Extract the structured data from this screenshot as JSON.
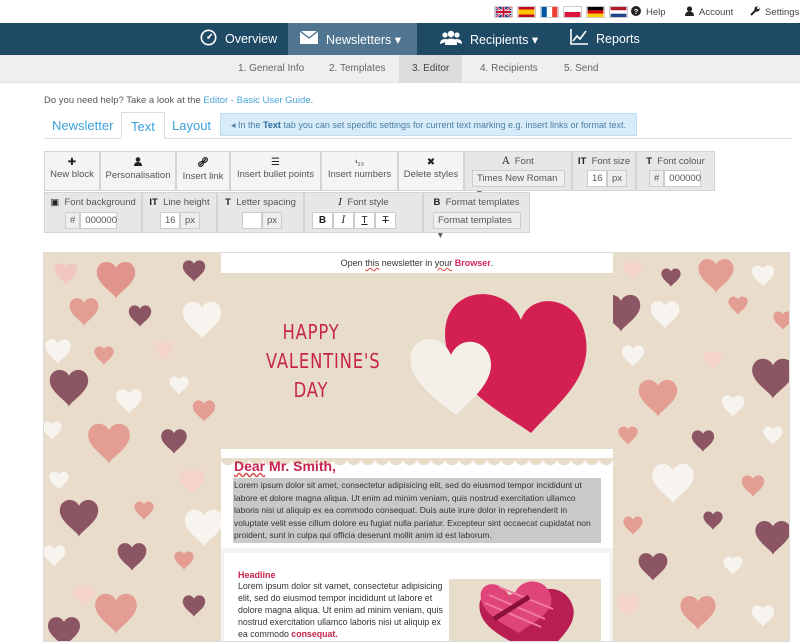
{
  "topbar": {
    "flags": [
      {
        "name": "flag-uk-icon",
        "colors": [
          "#1a3b8a",
          "#c8102e",
          "#ffffff"
        ]
      },
      {
        "name": "flag-spain-icon",
        "colors": [
          "#c60b1e",
          "#ffc400",
          "#c60b1e"
        ]
      },
      {
        "name": "flag-france-icon",
        "colors": [
          "#0055a4",
          "#ffffff",
          "#ef4135"
        ]
      },
      {
        "name": "flag-poland-icon",
        "colors": [
          "#ffffff",
          "#dc143c"
        ]
      },
      {
        "name": "flag-germany-icon",
        "colors": [
          "#000000",
          "#dd0000",
          "#ffce00"
        ]
      },
      {
        "name": "flag-netherlands-icon",
        "colors": [
          "#ae1c28",
          "#ffffff",
          "#21468b"
        ]
      }
    ],
    "help": "Help",
    "account": "Account",
    "settings": "Settings"
  },
  "nav": {
    "overview": "Overview",
    "newsletters": "Newsletters ▾",
    "recipients": "Recipients ▾",
    "reports": "Reports"
  },
  "steps": [
    "1. General Info",
    "2. Templates",
    "3. Editor",
    "4. Recipients",
    "5. Send"
  ],
  "help": {
    "prefix": "Do you need help? Take a look at the ",
    "link": "Editor - Basic User Guide",
    "suffix": "."
  },
  "tabs": [
    "Newsletter",
    "Text",
    "Layout"
  ],
  "hint": {
    "prefix": "◂ In the ",
    "bold": "Text",
    "suffix": " tab you can set specific settings for current text marking e.g. insert links or format text."
  },
  "toolbar": {
    "new_block": "New block",
    "personalisation": "Personalisation",
    "insert_link": "Insert link",
    "bullets": "Insert bullet points",
    "numbers": "Insert numbers",
    "delete_styles": "Delete styles",
    "font_label": "Font",
    "font_value": "Times New Roman ▾",
    "font_size_label": "Font size",
    "font_size_value": "16",
    "font_colour_label": "Font colour",
    "font_colour_value": "000000",
    "font_bg_label": "Font background",
    "font_bg_value": "000000",
    "line_height_label": "Line height",
    "line_height_value": "16",
    "letter_spacing_label": "Letter spacing",
    "letter_spacing_value": "",
    "font_style_label": "Font style",
    "format_templates_label": "Format templates",
    "format_templates_value": "Format templates ▾",
    "unit_px": "px",
    "hash": "#",
    "bold_glyph": "B",
    "italic_glyph": "I",
    "underline_glyph": "T",
    "strike_glyph": "T"
  },
  "email": {
    "open_prefix": "Open ",
    "open_this": "this",
    "open_mid": " newsletter in ",
    "open_your": "your",
    "open_space": " ",
    "open_link": "Browser",
    "open_suffix": ".",
    "banner_line1": "HAPPY",
    "banner_line2": "VALENTINE'S",
    "banner_line3": "DAY",
    "dear_prefix": "Dear",
    "dear_rest": " Mr. Smith,",
    "lorem": "Lorem ipsum dolor sit amet, consectetur adipisicing elit, sed do eiusmod tempor incididunt ut labore et dolore magna aliqua. Ut enim ad minim veniam, quis nostrud exercitation ullamco laboris nisi ut aliquip ex ea commodo consequat. Duis aute irure dolor in reprehenderit in voluptate velit esse cillum dolore eu fugiat nulla pariatur. Excepteur sint occaecat cupidatat non proident, sunt in culpa qui officia deserunt mollit anim id est laborum.",
    "headline": "Headline",
    "headline_text": "Lorem ipsum dolor sit vamet, consectetur adipisicing elit, sed do eiusmod tempor incididunt ut labore et dolore magna aliqua. Ut enim ad minim veniam, quis nostrud exercitation ullamco laboris nisi ut aliquip ex ea commodo ",
    "headline_bold": "consequat."
  },
  "colors": {
    "nav_bg": "#1e4a66",
    "nav_active": "#4f7590",
    "accent": "#c7254e",
    "link": "#3ca0dc",
    "canvas_bg": "#e9dccb"
  }
}
